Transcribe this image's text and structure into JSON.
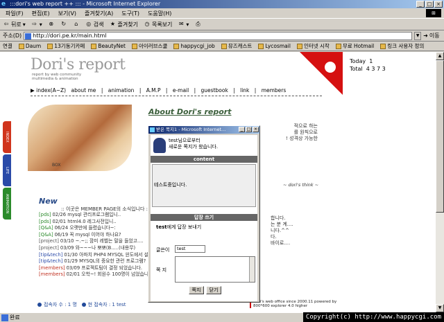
{
  "window": {
    "title": ":::dori's web report ++ ::: - Microsoft Internet Explorer"
  },
  "menu": [
    "파일(F)",
    "편집(E)",
    "보기(V)",
    "즐겨찾기(A)",
    "도구(T)",
    "도움말(H)"
  ],
  "toolbar": {
    "back": "뒤로",
    "search": "검색",
    "favorites": "즐겨찾기",
    "history": "목록보기"
  },
  "address": {
    "label": "주소(D)",
    "url": "http://dori.pe.kr/main.html",
    "go": "이동"
  },
  "links": {
    "label": "연결",
    "items": [
      "Daum",
      "13기동기카페",
      "BeautyNet",
      "아이러브스쿨",
      "happycgi_job",
      "뮤즈캐스트",
      "Lycosmail",
      "인터넷 시작",
      "무료 Hotmail",
      "링크 사용자 정의"
    ]
  },
  "site": {
    "logo": "Dori's report",
    "tagline": "report by web community multimedia & animation",
    "nav": [
      "▶ index(A~Z)",
      "about me",
      "|",
      "animation",
      "|",
      "A.M.P",
      "|",
      "e-mail",
      "|",
      "guestbook",
      "|",
      "link",
      "|",
      "members"
    ],
    "about_title": "About Dori's report",
    "photo_label": "BOX",
    "right_text": [
      "적으로 하는",
      "를 원칙으로",
      "",
      "",
      "",
      "! 성격상 가능한"
    ],
    "think": "~ dori's think ~",
    "right_lines": [
      "합니다.",
      "는 분 계....",
      "니다.^^",
      "",
      "다.",
      "바이로...."
    ],
    "new_title": "New",
    "new_sub": ":: 이곳은 MEMBER PAGE의 소식입니다 ::",
    "news": [
      {
        "cat": "[pds]",
        "text": "02/26 mysql 관리프로그램입니.."
      },
      {
        "cat": "[pds]",
        "text": "02/01 html4.0 레그사전입니.."
      },
      {
        "cat": "[Q&A]",
        "text": "06/24 오랫만에 들렸습니다~:"
      },
      {
        "cat": "[Q&A]",
        "text": "06/19 꼭 mysql 이어야 하나요?"
      },
      {
        "cat": "[project]",
        "text": "03/10 ~.~;; 깜미 레벨는 말을 들었고...."
      },
      {
        "cat": "[project]",
        "text": "03/09 와~~~나 뽀뽀(B.....(내용무)"
      },
      {
        "cat": "[tip&tech]",
        "text": "01/30 아파치 PHP4 MYSQL 윈도에서 설...."
      },
      {
        "cat": "[tip&tech]",
        "text": "01/29 MYSQL의 중요한 관련 프로그램?"
      },
      {
        "cat": "[members]",
        "text": "03/09 프로젝트팀이 결정 되었습니다."
      },
      {
        "cat": "[members]",
        "text": "02/01 오학~! 회원수 100명이 넘었습니..."
      }
    ],
    "visitors": "접속자 수 : 1 명",
    "current": "현 접속자 : 1 test",
    "powered": "Dori's web office since 2000.11 powered by 800*600 explorer 4.0 higher",
    "side_tabs": [
      "INDEX",
      "LIFE",
      "ANIMATION"
    ]
  },
  "counter": {
    "today_label": "Today",
    "today": "1",
    "total_label": "Total",
    "total": "4 3 7 3"
  },
  "popup": {
    "title": "받은 쪽지1 - Microsoft Internet...",
    "from_line": "test님으로부터",
    "notice": "새로운 쪽지가 왔습니다.",
    "content_label": "content",
    "content_text": "테스트중입니다.",
    "reply_label": "답장 쓰기",
    "reply_to_name": "test",
    "reply_to_suffix": "에게 답장 보내기",
    "name_label": "글쓴이",
    "name_value": "test",
    "msg_label": "쪽 지",
    "send": "쪽지",
    "close": "닫기"
  },
  "status": {
    "text": "완료"
  },
  "copyright": "Copyright(c) http://www.happycgi.com"
}
